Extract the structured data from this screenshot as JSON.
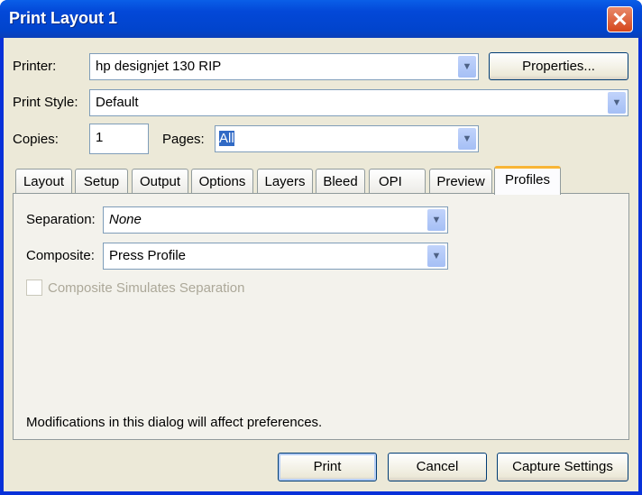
{
  "window": {
    "title": "Print Layout 1"
  },
  "printer": {
    "label": "Printer:",
    "value": "hp designjet 130 RIP",
    "properties_button": "Properties..."
  },
  "print_style": {
    "label": "Print Style:",
    "value": "Default"
  },
  "copies": {
    "label": "Copies:",
    "value": "1"
  },
  "pages": {
    "label": "Pages:",
    "value": "All"
  },
  "tabs": [
    {
      "label": "Layout"
    },
    {
      "label": "Setup"
    },
    {
      "label": "Output"
    },
    {
      "label": "Options"
    },
    {
      "label": "Layers"
    },
    {
      "label": "Bleed"
    },
    {
      "label": "OPI"
    },
    {
      "label": "Preview"
    },
    {
      "label": "Profiles",
      "active": true
    }
  ],
  "profiles": {
    "separation": {
      "label": "Separation:",
      "value": "None"
    },
    "composite": {
      "label": "Composite:",
      "value": "Press Profile"
    },
    "simulate_checkbox": {
      "label": "Composite Simulates Separation",
      "checked": false,
      "disabled": true
    },
    "note": "Modifications in this dialog will affect preferences."
  },
  "buttons": {
    "print": "Print",
    "cancel": "Cancel",
    "capture": "Capture Settings"
  }
}
